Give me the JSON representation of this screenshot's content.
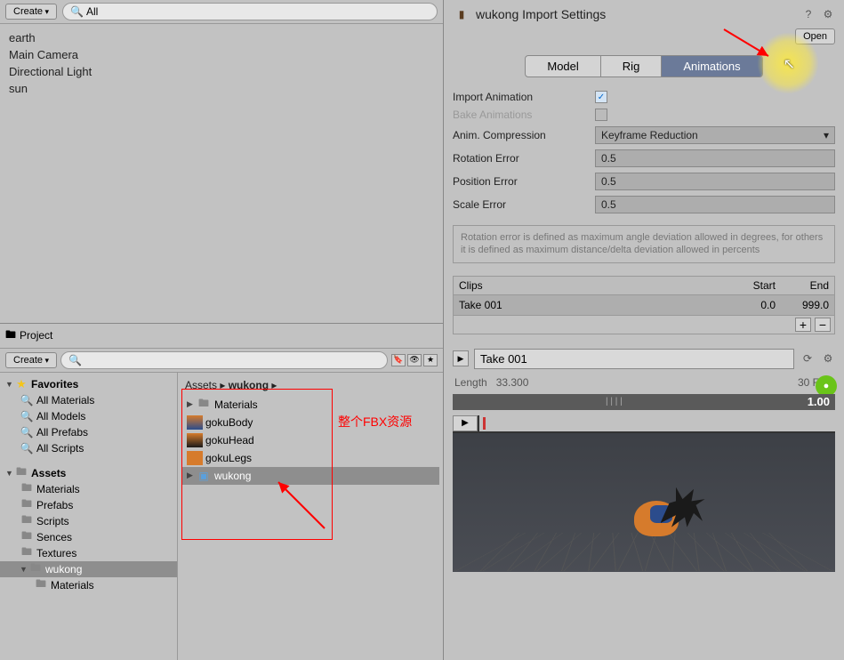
{
  "hierarchy": {
    "create_label": "Create",
    "search_placeholder": "All",
    "items": [
      "earth",
      "Main Camera",
      "Directional Light",
      "sun"
    ]
  },
  "project": {
    "title": "Project",
    "create_label": "Create",
    "favorites_label": "Favorites",
    "favorites": [
      "All Materials",
      "All Models",
      "All Prefabs",
      "All Scripts"
    ],
    "assets_label": "Assets",
    "folders": [
      "Materials",
      "Prefabs",
      "Scripts",
      "Sences",
      "Textures"
    ],
    "selected_folder": "wukong",
    "sub_folder": "Materials",
    "breadcrumb_root": "Assets",
    "breadcrumb_current": "wukong",
    "content_items": [
      "Materials",
      "gokuBody",
      "gokuHead",
      "gokuLegs",
      "wukong"
    ]
  },
  "annotation": {
    "fbx_label": "整个FBX资源"
  },
  "inspector": {
    "title": "wukong Import Settings",
    "open_label": "Open",
    "tabs": [
      "Model",
      "Rig",
      "Animations"
    ],
    "import_anim_label": "Import Animation",
    "bake_label": "Bake Animations",
    "compression_label": "Anim. Compression",
    "compression_value": "Keyframe Reduction",
    "rotation_label": "Rotation Error",
    "rotation_value": "0.5",
    "position_label": "Position Error",
    "position_value": "0.5",
    "scale_label": "Scale Error",
    "scale_value": "0.5",
    "hint": "Rotation error is defined as maximum angle deviation allowed in degrees, for others it is defined as maximum distance/delta deviation allowed in percents",
    "clips_header": "Clips",
    "start_header": "Start",
    "end_header": "End",
    "clip_name": "Take 001",
    "clip_start": "0.0",
    "clip_end": "999.0",
    "length_label": "Length",
    "length_value": "33.300",
    "fps_value": "30 FPS",
    "timeline_value": "1.00"
  },
  "chart_data": {
    "type": "table",
    "title": "Clips",
    "columns": [
      "Clips",
      "Start",
      "End"
    ],
    "rows": [
      [
        "Take 001",
        0.0,
        999.0
      ]
    ]
  }
}
